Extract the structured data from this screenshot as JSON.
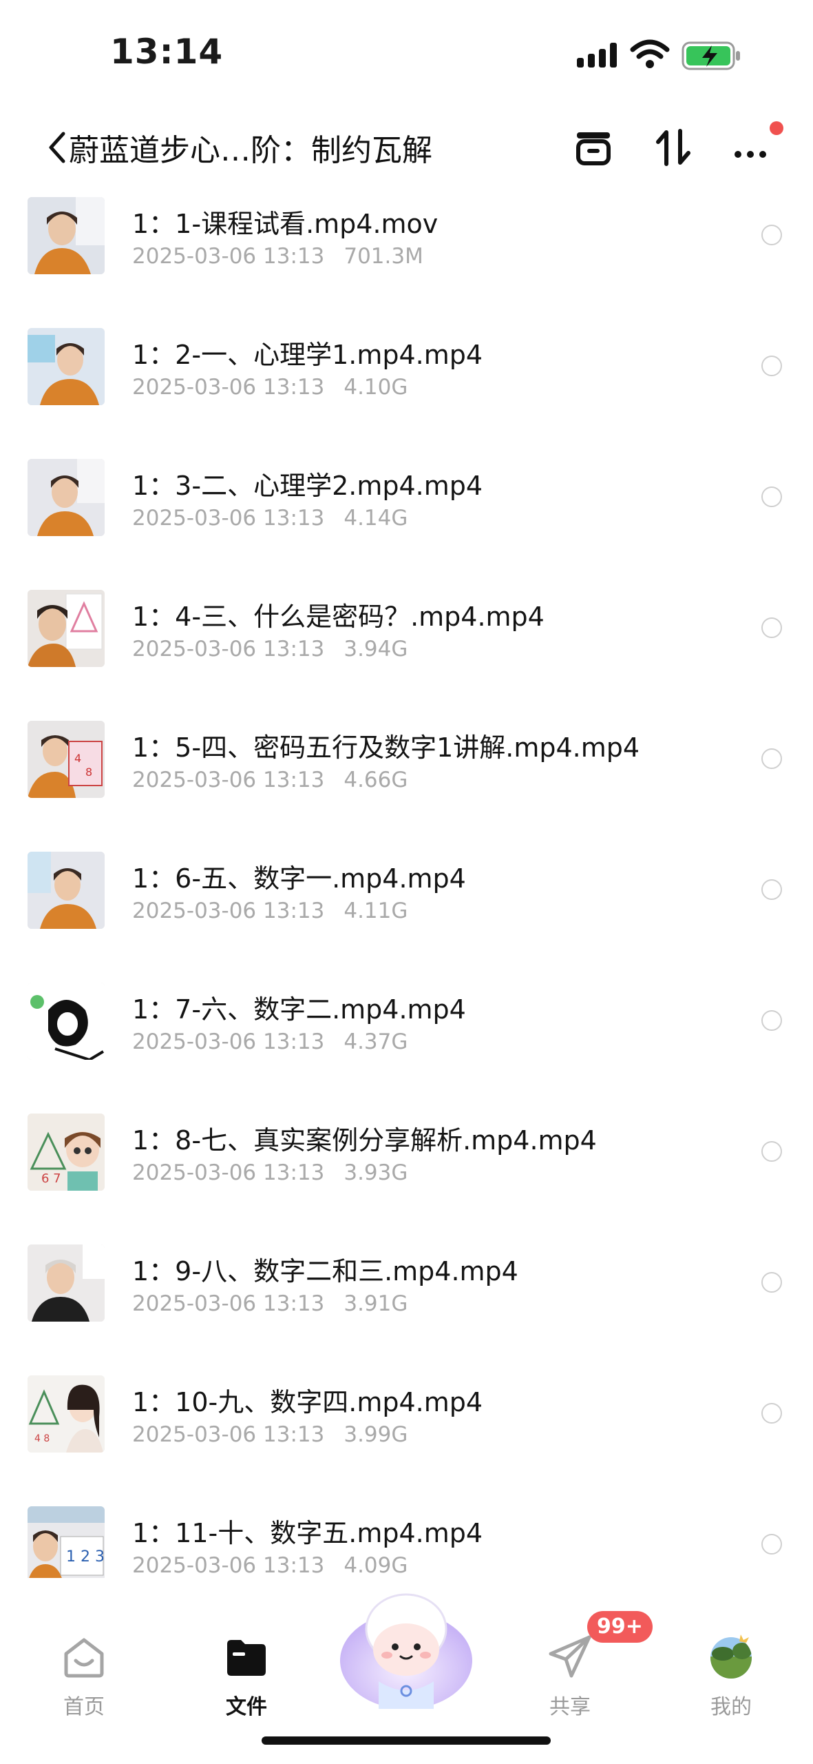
{
  "status_bar": {
    "time": "13:14"
  },
  "header": {
    "title": "蔚蓝道步心…阶：制约瓦解",
    "back_icon": "chevron-left-icon",
    "actions": [
      "archive-icon",
      "sort-icon",
      "more-icon"
    ]
  },
  "files": [
    {
      "name": "1：1-课程试看.mp4.mov",
      "date": "2025-03-06 13:13",
      "size": "701.3M"
    },
    {
      "name": "1：2-一、心理学1.mp4.mp4",
      "date": "2025-03-06 13:13",
      "size": "4.10G"
    },
    {
      "name": "1：3-二、心理学2.mp4.mp4",
      "date": "2025-03-06 13:13",
      "size": "4.14G"
    },
    {
      "name": "1：4-三、什么是密码？.mp4.mp4",
      "date": "2025-03-06 13:13",
      "size": "3.94G"
    },
    {
      "name": "1：5-四、密码五行及数字1讲解.mp4.mp4",
      "date": "2025-03-06 13:13",
      "size": "4.66G"
    },
    {
      "name": "1：6-五、数字一.mp4.mp4",
      "date": "2025-03-06 13:13",
      "size": "4.11G"
    },
    {
      "name": "1：7-六、数字二.mp4.mp4",
      "date": "2025-03-06 13:13",
      "size": "4.37G"
    },
    {
      "name": "1：8-七、真实案例分享解析.mp4.mp4",
      "date": "2025-03-06 13:13",
      "size": "3.93G"
    },
    {
      "name": "1：9-八、数字二和三.mp4.mp4",
      "date": "2025-03-06 13:13",
      "size": "3.91G"
    },
    {
      "name": "1：10-九、数字四.mp4.mp4",
      "date": "2025-03-06 13:13",
      "size": "3.99G"
    },
    {
      "name": "1：11-十、数字五.mp4.mp4",
      "date": "2025-03-06 13:13",
      "size": "4.09G"
    }
  ],
  "tab_bar": {
    "tabs": [
      {
        "label": "首页",
        "icon": "home-icon"
      },
      {
        "label": "文件",
        "icon": "folder-icon"
      },
      {
        "label": "共享",
        "icon": "send-icon",
        "badge": "99+"
      },
      {
        "label": "我的",
        "icon": "avatar"
      }
    ],
    "center": "assistant-mascot-icon"
  },
  "colors": {
    "accent_red": "#f0514f",
    "meta_gray": "#a9a9a9"
  }
}
